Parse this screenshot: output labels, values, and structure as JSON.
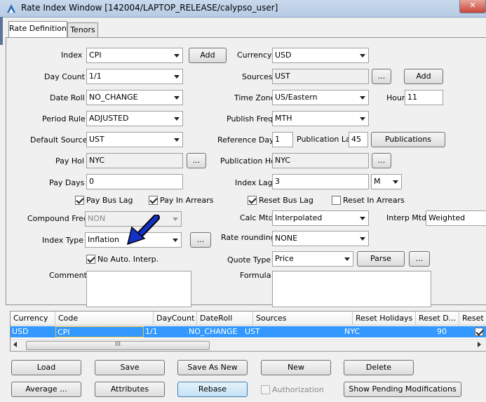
{
  "window": {
    "title": "Rate Index Window  [142004/LAPTOP_RELEASE/calypso_user]",
    "close_glyph": "✕"
  },
  "tabs": [
    {
      "label": "Rate Definition",
      "active": true
    },
    {
      "label": "Tenors",
      "active": false
    }
  ],
  "form": {
    "index": {
      "label": "Index",
      "value": "CPI"
    },
    "index_add": "Add",
    "currency": {
      "label": "Currency",
      "value": "USD"
    },
    "day_count": {
      "label": "Day Count",
      "value": "1/1"
    },
    "sources": {
      "label": "Sources",
      "value": "UST"
    },
    "sources_more": "...",
    "sources_add": "Add",
    "date_roll": {
      "label": "Date Roll",
      "value": "NO_CHANGE"
    },
    "time_zone": {
      "label": "Time Zone",
      "value": "US/Eastern"
    },
    "hour": {
      "label": "Hour",
      "value": "11"
    },
    "period_rule": {
      "label": "Period Rule",
      "value": "ADJUSTED"
    },
    "publish_freq": {
      "label": "Publish Freq",
      "value": "MTH"
    },
    "default_source": {
      "label": "Default Source",
      "value": "UST"
    },
    "reference_day": {
      "label": "Reference Day",
      "value": "1"
    },
    "publication_lag": {
      "label": "Publication Lag",
      "value": "45"
    },
    "publications_button": "Publications",
    "pay_hol": {
      "label": "Pay Hol",
      "value": "NYC"
    },
    "pay_hol_more": "...",
    "publication_hol": {
      "label": "Publication Hol",
      "value": "NYC"
    },
    "publication_hol_more": "...",
    "pay_days": {
      "label": "Pay Days",
      "value": "0"
    },
    "index_lag": {
      "label": "Index Lag",
      "value": "3",
      "unit": "M"
    },
    "pay_bus_lag": {
      "label": "Pay Bus Lag",
      "checked": true
    },
    "pay_in_arrears": {
      "label": "Pay In Arrears",
      "checked": true
    },
    "reset_bus_lag": {
      "label": "Reset Bus Lag",
      "checked": true
    },
    "reset_in_arrears": {
      "label": "Reset In Arrears",
      "checked": false
    },
    "compound_freq": {
      "label": "Compound Freq",
      "value": "NON"
    },
    "calc_mtd": {
      "label": "Calc Mtd",
      "value": "Interpolated"
    },
    "interp_mtd": {
      "label": "Interp Mtd",
      "value": "Weighted"
    },
    "index_type": {
      "label": "Index Type",
      "value": "Inflation"
    },
    "index_type_more": "...",
    "rate_rounding": {
      "label": "Rate rounding",
      "value": "NONE"
    },
    "no_auto_interp": {
      "label": "No Auto. Interp.",
      "checked": true
    },
    "quote_type": {
      "label": "Quote Type",
      "value": "Price"
    },
    "parse_button": "Parse",
    "quote_more": "...",
    "comment": {
      "label": "Comment",
      "value": ""
    },
    "formula": {
      "label": "Formula",
      "value": ""
    }
  },
  "table": {
    "columns": [
      "Currency",
      "Code",
      "DayCount",
      "DateRoll",
      "Sources",
      "Reset Holidays",
      "Reset D...",
      "Reset Bus"
    ],
    "rows": [
      {
        "currency": "USD",
        "code": "CPI",
        "daycount": "1/1",
        "dateroll": "NO_CHANGE",
        "sources": "UST",
        "reset_holidays": "NYC",
        "reset_days": "90",
        "reset_bus": true
      }
    ],
    "scroll_grip": "III"
  },
  "buttons": {
    "load": "Load",
    "save": "Save",
    "save_as_new": "Save As New",
    "new": "New",
    "delete": "Delete",
    "average": "Average ...",
    "attributes": "Attributes",
    "rebase": "Rebase",
    "authorization": "Authorization",
    "show_pending": "Show Pending Modifications"
  },
  "colors": {
    "selection": "#3399ff",
    "arrow_annotation": "#1432c8"
  }
}
